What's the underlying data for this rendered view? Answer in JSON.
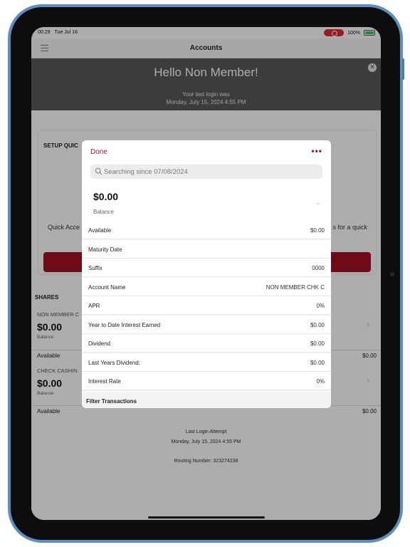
{
  "status_bar": {
    "time": "00:29",
    "date": "Tue Jul 16",
    "battery": "100%"
  },
  "nav": {
    "title": "Accounts"
  },
  "banner": {
    "greeting": "Hello Non Member!",
    "last_login_line1": "Your last login was",
    "last_login_line2": "Monday, July 15, 2024 4:55 PM"
  },
  "setup": {
    "title": "SETUP QUIC",
    "text_left": "Quick Acce",
    "text_right": "s for a quick"
  },
  "shares": {
    "label": "SHARES",
    "items": [
      {
        "name": "NON MEMBER C",
        "amount": "$0.00",
        "balance_label": "Balance",
        "available_label": "Available",
        "available_value": "$0.00"
      },
      {
        "name": "CHECK CASHIN",
        "amount": "$0.00",
        "balance_label": "Balance",
        "available_label": "Available",
        "available_value": "$0.00"
      }
    ]
  },
  "footer": {
    "login_title": "Last Login Attempt",
    "login_date": "Monday, July 15, 2024 4:55 PM",
    "routing": "Routing Number: 323274238"
  },
  "modal": {
    "done_label": "Done",
    "more_label": "•••",
    "search_placeholder": "Searching since 07/08/2024",
    "balance_amount": "$0.00",
    "balance_label": "Balance",
    "details": [
      {
        "key": "Available",
        "value": "$0.00"
      },
      {
        "key": "Maturity Date",
        "value": ""
      },
      {
        "key": "Suffix",
        "value": "0000"
      },
      {
        "key": "Account Name",
        "value": "NON MEMBER CHK C"
      },
      {
        "key": "APR",
        "value": "0%"
      },
      {
        "key": "Year to Date Interest Earned",
        "value": "$0.00"
      },
      {
        "key": "Dividend",
        "value": "$0.00"
      },
      {
        "key": "Last Years Dividend:",
        "value": "$0.00"
      },
      {
        "key": "Interest Rate",
        "value": "0%"
      }
    ],
    "filter_label": "Filter Transactions"
  },
  "colors": {
    "accent": "#9b1a2a",
    "banner": "#595959",
    "button": "#a31121"
  }
}
